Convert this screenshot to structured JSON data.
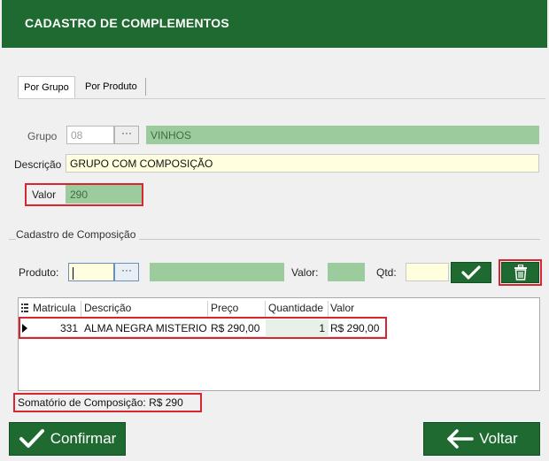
{
  "header": {
    "title": "CADASTRO DE COMPLEMENTOS"
  },
  "tabs": [
    {
      "label": "Por Grupo",
      "active": true
    },
    {
      "label": "Por Produto",
      "active": false
    }
  ],
  "form": {
    "grupo_label": "Grupo",
    "grupo_code": "08",
    "grupo_btn": "···",
    "grupo_name": "VINHOS",
    "descricao_label": "Descrição",
    "descricao_value": "GRUPO COM COMPOSIÇÃO",
    "valor_label": "Valor",
    "valor_value": "290"
  },
  "composicao": {
    "title": "Cadastro de Composição",
    "produto_label": "Produto:",
    "produto_btn": "···",
    "produto_value": "",
    "produto_name": "",
    "valor_label": "Valor:",
    "valor_value": "",
    "qtd_label": "Qtd:",
    "qtd_value": ""
  },
  "grid": {
    "columns": [
      "Matricula",
      "Descrição",
      "Preço",
      "Quantidade",
      "Valor"
    ],
    "rows": [
      {
        "matricula": "331",
        "descricao": "ALMA NEGRA MISTERIO",
        "preco": "R$ 290,00",
        "quantidade": "1",
        "valor": "R$ 290,00"
      }
    ]
  },
  "summary": {
    "text": "Somatório de Composição: R$ 290"
  },
  "footer": {
    "confirm_label": "Confirmar",
    "back_label": "Voltar"
  },
  "colors": {
    "brand_green": "#1e6a30",
    "field_green": "#9ccb9d",
    "highlight_red": "#d7262f",
    "field_yellow": "#ffffe0"
  }
}
